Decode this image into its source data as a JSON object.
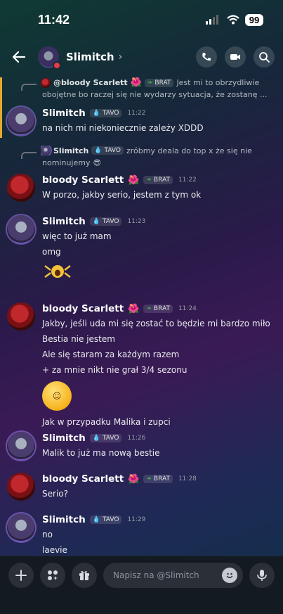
{
  "status": {
    "time": "11:42",
    "battery": "99"
  },
  "header": {
    "name": "Slimitch"
  },
  "reply1": {
    "author": "@bloody Scarlett",
    "tag": "BRAT",
    "text_line1": "Jest mi to obrzydliwie",
    "text_line2": "obojętne bo raczej się nie wydarzy sytuacja, że zostanę ..."
  },
  "reply2": {
    "author": "Slimitch",
    "tag": "TAVO",
    "text_line1": "zróbmy deala do top x że się nie",
    "text_line2": "nominujemy"
  },
  "messages": [
    {
      "author": "Slimitch",
      "tag": "TAVO",
      "time": "11:22",
      "lines": [
        "na nich mi niekoniecznie zależy XDDD"
      ]
    },
    {
      "author": "bloody Scarlett",
      "tag": "BRAT",
      "time": "11:22",
      "lines": [
        "W porzo, jakby serio, jestem z tym ok"
      ]
    },
    {
      "author": "Slimitch",
      "tag": "TAVO",
      "time": "11:23",
      "lines": [
        "więc to już mam",
        "omg"
      ]
    },
    {
      "author": "bloody Scarlett",
      "tag": "BRAT",
      "time": "11:24",
      "lines": [
        "Jakby, jeśli uda mi się zostać to będzie mi bardzo miło",
        "Bestia nie jestem",
        "Ale się staram za każdym razem",
        "+ za mnie nikt nie grał 3/4 sezonu",
        "Jak w przypadku Malika i zupci"
      ]
    },
    {
      "author": "Slimitch",
      "tag": "TAVO",
      "time": "11:26",
      "lines": [
        "Malik to już ma nową bestie"
      ]
    },
    {
      "author": "bloody Scarlett",
      "tag": "BRAT",
      "time": "11:28",
      "lines": [
        "Serio?"
      ]
    },
    {
      "author": "Slimitch",
      "tag": "TAVO",
      "time": "11:29",
      "lines": [
        "no",
        "laevie"
      ]
    }
  ],
  "composer": {
    "placeholder": "Napisz na @Slimitch"
  },
  "colors": {
    "accent_gold": "#e6a92d",
    "dnd_red": "#e33d45",
    "tag_green": "#3fae4a"
  },
  "icons": [
    "back-arrow-icon",
    "chevron-right-icon",
    "phone-icon",
    "video-icon",
    "search-icon",
    "plus-icon",
    "apps-icon",
    "gift-icon",
    "emoji-icon",
    "mic-icon"
  ]
}
